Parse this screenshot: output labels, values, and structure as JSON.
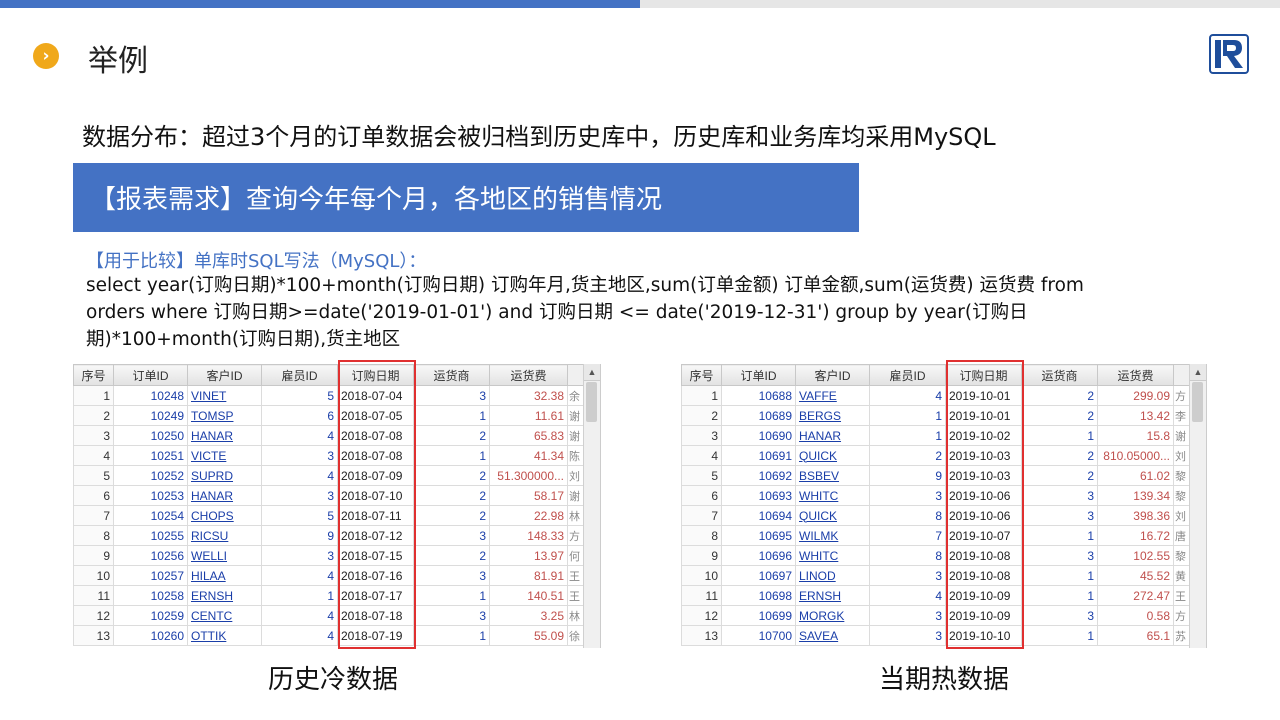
{
  "page": {
    "title": "举例",
    "description": "数据分布：超过3个月的订单数据会被归档到历史库中，历史库和业务库均采用MySQL",
    "banner": "【报表需求】查询今年每个月，各地区的销售情况",
    "compare_label": "【用于比较】单库时SQL写法（MySQL）：",
    "sql_lines": [
      "select  year(订购日期)*100+month(订购日期)  订购年月,货主地区,sum(订单金额)  订单金额,sum(运货费)  运货费   from",
      "orders where 订购日期>=date('2019-01-01')   and 订购日期 <= date('2019-12-31')  group by year(订购日",
      "期)*100+month(订购日期),货主地区"
    ]
  },
  "colors": {
    "accent": "#4472c4",
    "bullet": "#f0a81a",
    "highlight": "#e03030"
  },
  "icons": {
    "bullet": "chevron-right-icon",
    "logo": "r-logo-icon"
  },
  "headers": [
    "序号",
    "订单ID",
    "客户ID",
    "雇员ID",
    "订购日期",
    "运货商",
    "运货费"
  ],
  "history_table": {
    "caption": "历史冷数据",
    "rows": [
      [
        "1",
        "10248",
        "VINET",
        "5",
        "2018-07-04",
        "3",
        "32.38",
        "余"
      ],
      [
        "2",
        "10249",
        "TOMSP",
        "6",
        "2018-07-05",
        "1",
        "11.61",
        "谢"
      ],
      [
        "3",
        "10250",
        "HANAR",
        "4",
        "2018-07-08",
        "2",
        "65.83",
        "谢"
      ],
      [
        "4",
        "10251",
        "VICTE",
        "3",
        "2018-07-08",
        "1",
        "41.34",
        "陈"
      ],
      [
        "5",
        "10252",
        "SUPRD",
        "4",
        "2018-07-09",
        "2",
        "51.300000...",
        "刘"
      ],
      [
        "6",
        "10253",
        "HANAR",
        "3",
        "2018-07-10",
        "2",
        "58.17",
        "谢"
      ],
      [
        "7",
        "10254",
        "CHOPS",
        "5",
        "2018-07-11",
        "2",
        "22.98",
        "林"
      ],
      [
        "8",
        "10255",
        "RICSU",
        "9",
        "2018-07-12",
        "3",
        "148.33",
        "方"
      ],
      [
        "9",
        "10256",
        "WELLI",
        "3",
        "2018-07-15",
        "2",
        "13.97",
        "何"
      ],
      [
        "10",
        "10257",
        "HILAA",
        "4",
        "2018-07-16",
        "3",
        "81.91",
        "王"
      ],
      [
        "11",
        "10258",
        "ERNSH",
        "1",
        "2018-07-17",
        "1",
        "140.51",
        "王"
      ],
      [
        "12",
        "10259",
        "CENTC",
        "4",
        "2018-07-18",
        "3",
        "3.25",
        "林"
      ],
      [
        "13",
        "10260",
        "OTTIK",
        "4",
        "2018-07-19",
        "1",
        "55.09",
        "徐"
      ]
    ]
  },
  "current_table": {
    "caption": "当期热数据",
    "rows": [
      [
        "1",
        "10688",
        "VAFFE",
        "4",
        "2019-10-01",
        "2",
        "299.09",
        "方"
      ],
      [
        "2",
        "10689",
        "BERGS",
        "1",
        "2019-10-01",
        "2",
        "13.42",
        "李"
      ],
      [
        "3",
        "10690",
        "HANAR",
        "1",
        "2019-10-02",
        "1",
        "15.8",
        "谢"
      ],
      [
        "4",
        "10691",
        "QUICK",
        "2",
        "2019-10-03",
        "2",
        "810.05000...",
        "刘"
      ],
      [
        "5",
        "10692",
        "BSBEV",
        "9",
        "2019-10-03",
        "2",
        "61.02",
        "黎"
      ],
      [
        "6",
        "10693",
        "WHITC",
        "3",
        "2019-10-06",
        "3",
        "139.34",
        "黎"
      ],
      [
        "7",
        "10694",
        "QUICK",
        "8",
        "2019-10-06",
        "3",
        "398.36",
        "刘"
      ],
      [
        "8",
        "10695",
        "WILMK",
        "7",
        "2019-10-07",
        "1",
        "16.72",
        "唐"
      ],
      [
        "9",
        "10696",
        "WHITC",
        "8",
        "2019-10-08",
        "3",
        "102.55",
        "黎"
      ],
      [
        "10",
        "10697",
        "LINOD",
        "3",
        "2019-10-08",
        "1",
        "45.52",
        "黄"
      ],
      [
        "11",
        "10698",
        "ERNSH",
        "4",
        "2019-10-09",
        "1",
        "272.47",
        "王"
      ],
      [
        "12",
        "10699",
        "MORGK",
        "3",
        "2019-10-09",
        "3",
        "0.58",
        "方"
      ],
      [
        "13",
        "10700",
        "SAVEA",
        "3",
        "2019-10-10",
        "1",
        "65.1",
        "苏"
      ]
    ]
  }
}
